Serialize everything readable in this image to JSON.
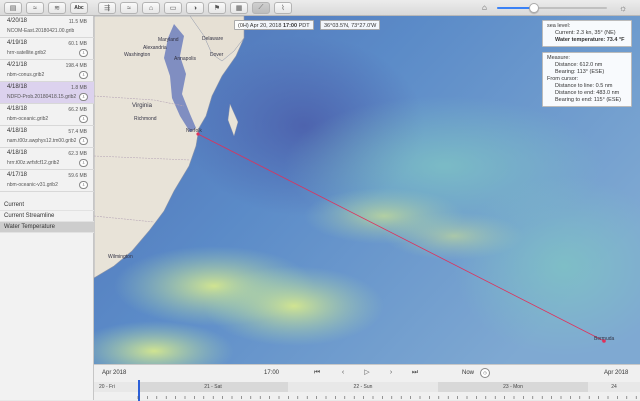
{
  "toolbar": {
    "buttons": [
      {
        "icon": "layers-icon",
        "glyph": "▤"
      },
      {
        "icon": "waves-icon",
        "glyph": "≈"
      },
      {
        "icon": "wind-icon",
        "glyph": "≋"
      },
      {
        "icon": "text-label-icon",
        "glyph": "Abc"
      },
      {
        "icon": "current-icon",
        "glyph": "⇶"
      },
      {
        "icon": "pressure-icon",
        "glyph": "≈"
      },
      {
        "icon": "tide-icon",
        "glyph": "⌂"
      },
      {
        "icon": "temperature-icon",
        "glyph": "▭"
      },
      {
        "icon": "gauge-icon",
        "glyph": "◑"
      },
      {
        "icon": "wind-barb-icon",
        "glyph": "⚑"
      },
      {
        "icon": "grid-icon",
        "glyph": "▦"
      },
      {
        "icon": "measure-line-icon",
        "glyph": "⟋"
      },
      {
        "icon": "route-icon",
        "glyph": "⌇"
      }
    ],
    "time_slider_value": 0.34
  },
  "files": [
    {
      "date": "4/20/18",
      "size": "11.5 MB",
      "name": "NCOM-East.20180421.00.grib"
    },
    {
      "date": "4/19/18",
      "size": "60.1 MB",
      "name": "hrrr-satellite.grib2"
    },
    {
      "date": "4/21/18",
      "size": "198.4 MB",
      "name": "nbm-conus.grib2"
    },
    {
      "date": "4/18/18",
      "size": "1.8 MB",
      "name": "NDFD-Prob.20180418.15.grib2",
      "selected": true
    },
    {
      "date": "4/18/18",
      "size": "66.2 MB",
      "name": "nbm-oceanic.grib2"
    },
    {
      "date": "4/18/18",
      "size": "57.4 MB",
      "name": "nam.t00z.awphys12.tm00.grib2"
    },
    {
      "date": "4/18/18",
      "size": "62.3 MB",
      "name": "hrrr.t00z.wrfsfcf12.grib2"
    },
    {
      "date": "4/17/18",
      "size": "59.6 MB",
      "name": "nbm-oceanic-v31.grib2"
    }
  ],
  "layers": [
    {
      "label": "Current",
      "selected": false
    },
    {
      "label": "Current Streamline",
      "selected": false
    },
    {
      "label": "Water Temperature",
      "selected": true
    }
  ],
  "map": {
    "places": [
      "Maryland",
      "Delaware",
      "Alexandria",
      "Washington",
      "Annapolis",
      "Dover",
      "Virginia",
      "Richmond",
      "Norfolk",
      "Wilmington",
      "Bermuda"
    ],
    "time_tooltip": "(0H) Apr 20, 2018 17:00 PDT",
    "time_tooltip_prefix": "(0H) Apr 20, 2018",
    "time_tooltip_time": "17:00",
    "time_tooltip_tz": "PDT",
    "coord_tooltip": "36°03.5'N, 73°27.0'W",
    "sea_panel": {
      "title": "sea level:",
      "current": "Current: 2.3 kn, 35° (NE)",
      "water_temp": "Water temperature: 73.4 °F"
    },
    "measure_panel": {
      "title": "Measure:",
      "distance": "Distance: 612.0 nm",
      "bearing": "Bearing: 113° (ESE)",
      "from_cursor": "From cursor:",
      "to_line": "Distance to line: 0.5 nm",
      "to_end": "Distance to end: 483.0 nm",
      "bearing_end": "Bearing to end: 115° (ESE)"
    },
    "colors": {
      "sea": "#5a86c2",
      "warm": "#c9e28a",
      "land": "#e9e4da",
      "route": "#e0305a"
    }
  },
  "timeline": {
    "left_date": "Apr 2018",
    "time": "17:00",
    "now_label": "Now",
    "right_date": "Apr 2018",
    "days": [
      {
        "label": "20 - Fri"
      },
      {
        "label": "21 - Sat"
      },
      {
        "label": "22 - Sun"
      },
      {
        "label": "23 - Mon"
      },
      {
        "label": "24"
      }
    ]
  }
}
